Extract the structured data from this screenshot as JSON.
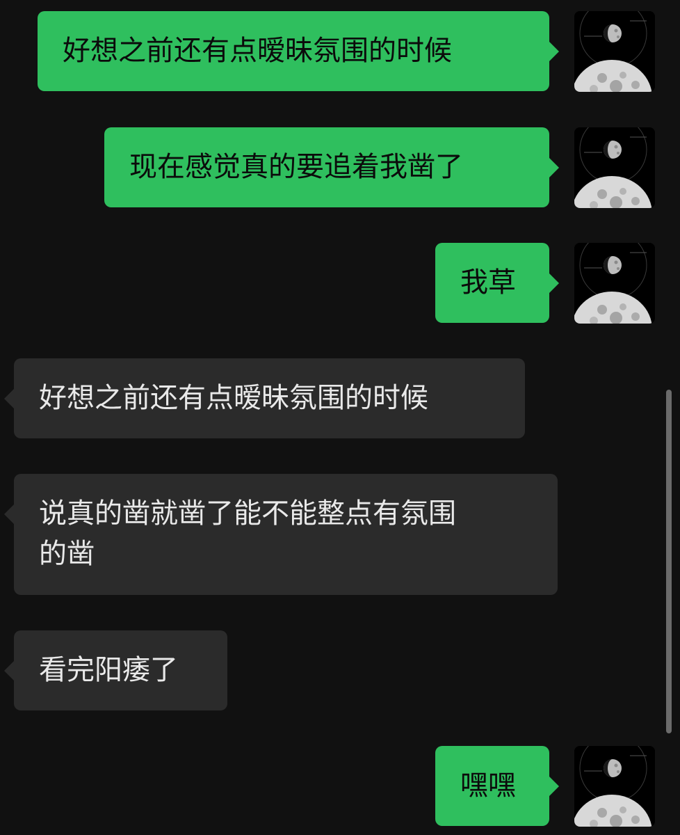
{
  "messages": [
    {
      "side": "sent",
      "text": "好想之前还有点暧昧氛围的时候"
    },
    {
      "side": "sent",
      "text": "现在感觉真的要追着我凿了"
    },
    {
      "side": "sent",
      "text": "我草"
    },
    {
      "side": "received",
      "text": "好想之前还有点暧昧氛围的时候"
    },
    {
      "side": "received",
      "text": "说真的凿就凿了能不能整点有氛围\n的凿"
    },
    {
      "side": "received",
      "text": "看完阳痿了"
    },
    {
      "side": "sent",
      "text": "嘿嘿"
    }
  ],
  "avatar": {
    "icon": "moon-icon"
  },
  "colors": {
    "background": "#111111",
    "sent_bubble": "#2fbf5e",
    "received_bubble": "#2b2b2b"
  }
}
